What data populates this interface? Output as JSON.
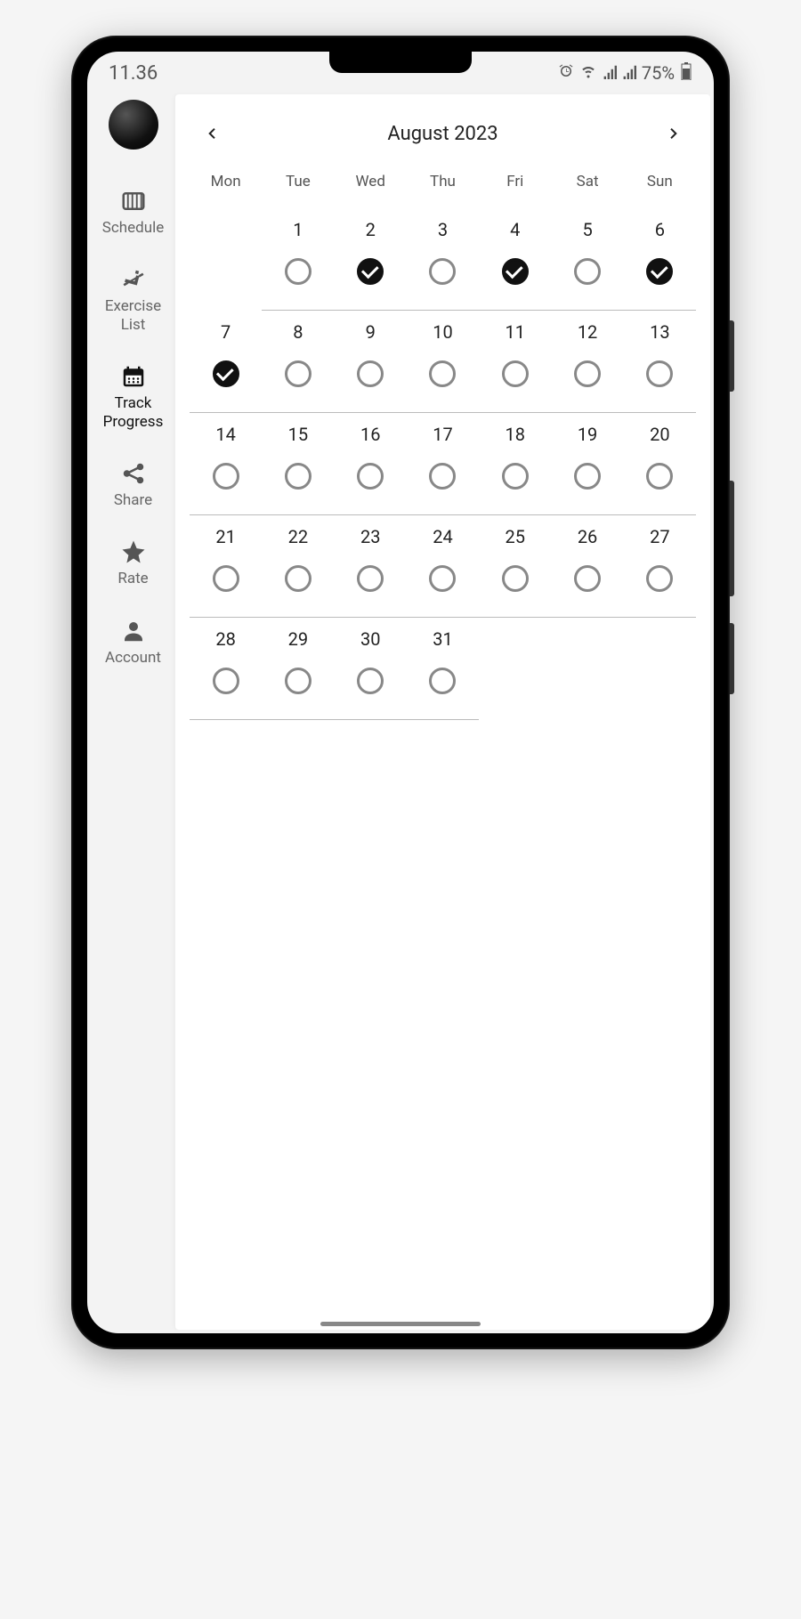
{
  "status": {
    "time": "11.36",
    "battery": "75%"
  },
  "sidebar": {
    "items": [
      {
        "icon": "schedule",
        "label": "Schedule"
      },
      {
        "icon": "exercise",
        "label": "Exercise List"
      },
      {
        "icon": "track",
        "label": "Track Progress"
      },
      {
        "icon": "share",
        "label": "Share"
      },
      {
        "icon": "rate",
        "label": "Rate"
      },
      {
        "icon": "account",
        "label": "Account"
      }
    ]
  },
  "calendar": {
    "month_label": "August 2023",
    "weekdays": [
      "Mon",
      "Tue",
      "Wed",
      "Thu",
      "Fri",
      "Sat",
      "Sun"
    ],
    "start_offset": 1,
    "days": [
      {
        "n": 1,
        "checked": false
      },
      {
        "n": 2,
        "checked": true
      },
      {
        "n": 3,
        "checked": false
      },
      {
        "n": 4,
        "checked": true
      },
      {
        "n": 5,
        "checked": false
      },
      {
        "n": 6,
        "checked": true
      },
      {
        "n": 7,
        "checked": true
      },
      {
        "n": 8,
        "checked": false
      },
      {
        "n": 9,
        "checked": false
      },
      {
        "n": 10,
        "checked": false
      },
      {
        "n": 11,
        "checked": false
      },
      {
        "n": 12,
        "checked": false
      },
      {
        "n": 13,
        "checked": false
      },
      {
        "n": 14,
        "checked": false
      },
      {
        "n": 15,
        "checked": false
      },
      {
        "n": 16,
        "checked": false
      },
      {
        "n": 17,
        "checked": false
      },
      {
        "n": 18,
        "checked": false
      },
      {
        "n": 19,
        "checked": false
      },
      {
        "n": 20,
        "checked": false
      },
      {
        "n": 21,
        "checked": false
      },
      {
        "n": 22,
        "checked": false
      },
      {
        "n": 23,
        "checked": false
      },
      {
        "n": 24,
        "checked": false
      },
      {
        "n": 25,
        "checked": false
      },
      {
        "n": 26,
        "checked": false
      },
      {
        "n": 27,
        "checked": false
      },
      {
        "n": 28,
        "checked": false
      },
      {
        "n": 29,
        "checked": false
      },
      {
        "n": 30,
        "checked": false
      },
      {
        "n": 31,
        "checked": false
      }
    ]
  }
}
